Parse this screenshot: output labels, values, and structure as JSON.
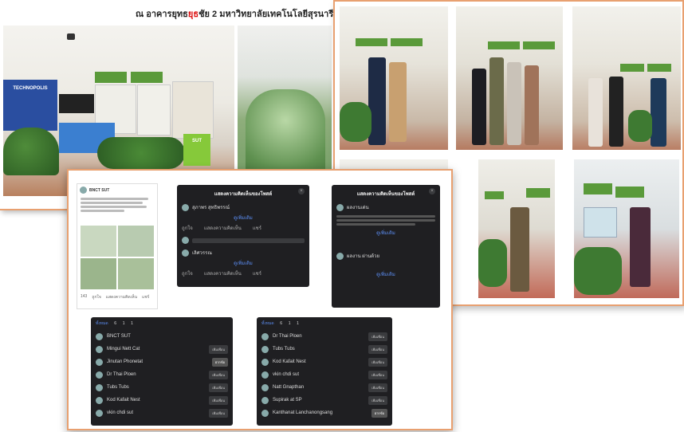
{
  "caption": {
    "prefix": "ณ อาคารยุทธ",
    "highlight": "ยุธ",
    "rest": "ชัย 2 มหาวิทยาลัยเทคโนโลยีสุรนารี"
  },
  "booth": {
    "sign_label": "TECHNOPOLIS",
    "box_label": "SUT"
  },
  "post": {
    "author": "BNCT SUT",
    "reactions": "143",
    "actions": [
      "ถูกใจ",
      "แสดงความคิดเห็น",
      "แชร์"
    ]
  },
  "comments_dark": {
    "title": "แสดงความคิดเห็นของโพสต์",
    "items": [
      {
        "name": "สุภาพร สุทธิพรรณ์",
        "link": "ดูเพิ่มเติม"
      },
      {
        "name": "เลิศวรรณ",
        "link": "ดูเพิ่มเติม"
      }
    ],
    "actions": [
      "ถูกใจ",
      "แสดงความคิดเห็น",
      "แชร์"
    ]
  },
  "comments_dark_right": {
    "title": "แสดงความคิดเห็นของโพสต์",
    "items": [
      {
        "name": "ผลงานเด่น",
        "link": "ดูเพิ่มเติม"
      },
      {
        "name": "ผลงาน ผ่านด้วย",
        "link": "ดูเพิ่มเติม"
      }
    ]
  },
  "reactions_left": {
    "tabs": [
      "ทั้งหมด",
      "6",
      "1",
      "1"
    ],
    "people": [
      "BNCT SUT",
      "Mingui Nett Cat",
      "Jinutan Phonetat",
      "Dr Thai Ploen",
      "Tubs Tubs",
      "Kod Kafait Nest",
      "vkin chdi sut"
    ],
    "button": "เพิ่มเพื่อน",
    "highlight_button": "ฝากข้อ"
  },
  "reactions_right": {
    "tabs": [
      "ทั้งหมด",
      "6",
      "1",
      "1"
    ],
    "people": [
      "Dr Thai Ploen",
      "Tubs Tubs",
      "Kod Kafait Nest",
      "vkin chdi sut",
      "Natt Gnapthan",
      "Supirak at SP",
      "Kanthanat Lanchanongsang"
    ],
    "button": "เพิ่มเพื่อน",
    "highlight_button": "ฝากข้อ"
  },
  "colors": {
    "frame": "#e8a070",
    "dark_panel": "#1f1f22",
    "accent_blue": "#5b8cf0",
    "banner_green": "#5a9a3a"
  }
}
